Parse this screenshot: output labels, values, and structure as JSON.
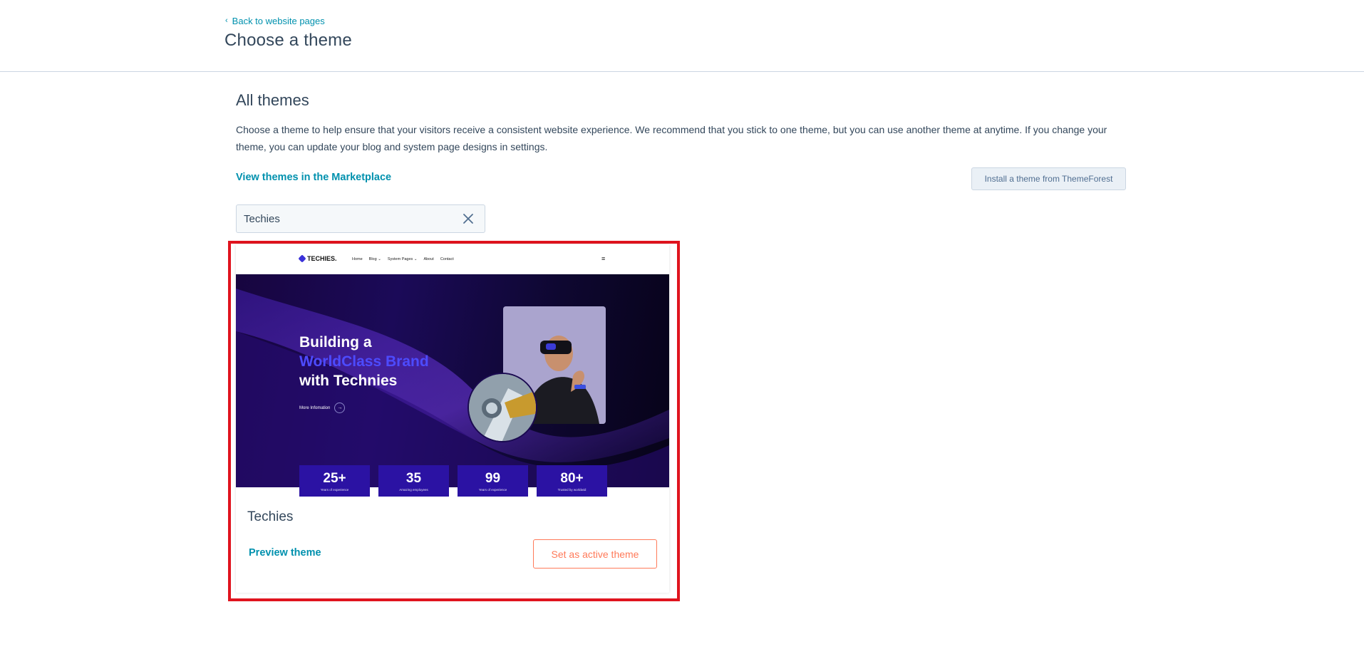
{
  "header": {
    "back_label": "Back to website pages",
    "title": "Choose a theme"
  },
  "main": {
    "section_title": "All themes",
    "description": "Choose a theme to help ensure that your visitors receive a consistent website experience. We recommend that you stick to one theme, but you can use another theme at anytime. If you change your theme, you can update your blog and system page designs in settings.",
    "marketplace_link": "View themes in the Marketplace",
    "install_button": "Install a theme from ThemeForest",
    "search": {
      "value": "Techies"
    }
  },
  "theme_card": {
    "name": "Techies",
    "preview_label": "Preview theme",
    "activate_label": "Set as active theme",
    "thumbnail": {
      "logo": "TECHIES.",
      "menu": [
        "Home",
        "Blog ⌄",
        "System Pages ⌄",
        "About",
        "Contact"
      ],
      "burger": "≡",
      "headline_line1": "Building a",
      "headline_line2": "WorldClass Brand",
      "headline_line3": "with Technies",
      "more_label": "More Infomation",
      "more_arrow": "→",
      "stats": [
        {
          "num": "25+",
          "label": "Years of experience"
        },
        {
          "num": "35",
          "label": "Amazing employees"
        },
        {
          "num": "99",
          "label": "Years of experience"
        },
        {
          "num": "80+",
          "label": "Trusted by worldwid"
        }
      ]
    }
  },
  "colors": {
    "link": "#0091ae",
    "accent": "#ff7a59",
    "highlight": "#e0141e",
    "hero_stat_bg": "#2b12a3"
  }
}
